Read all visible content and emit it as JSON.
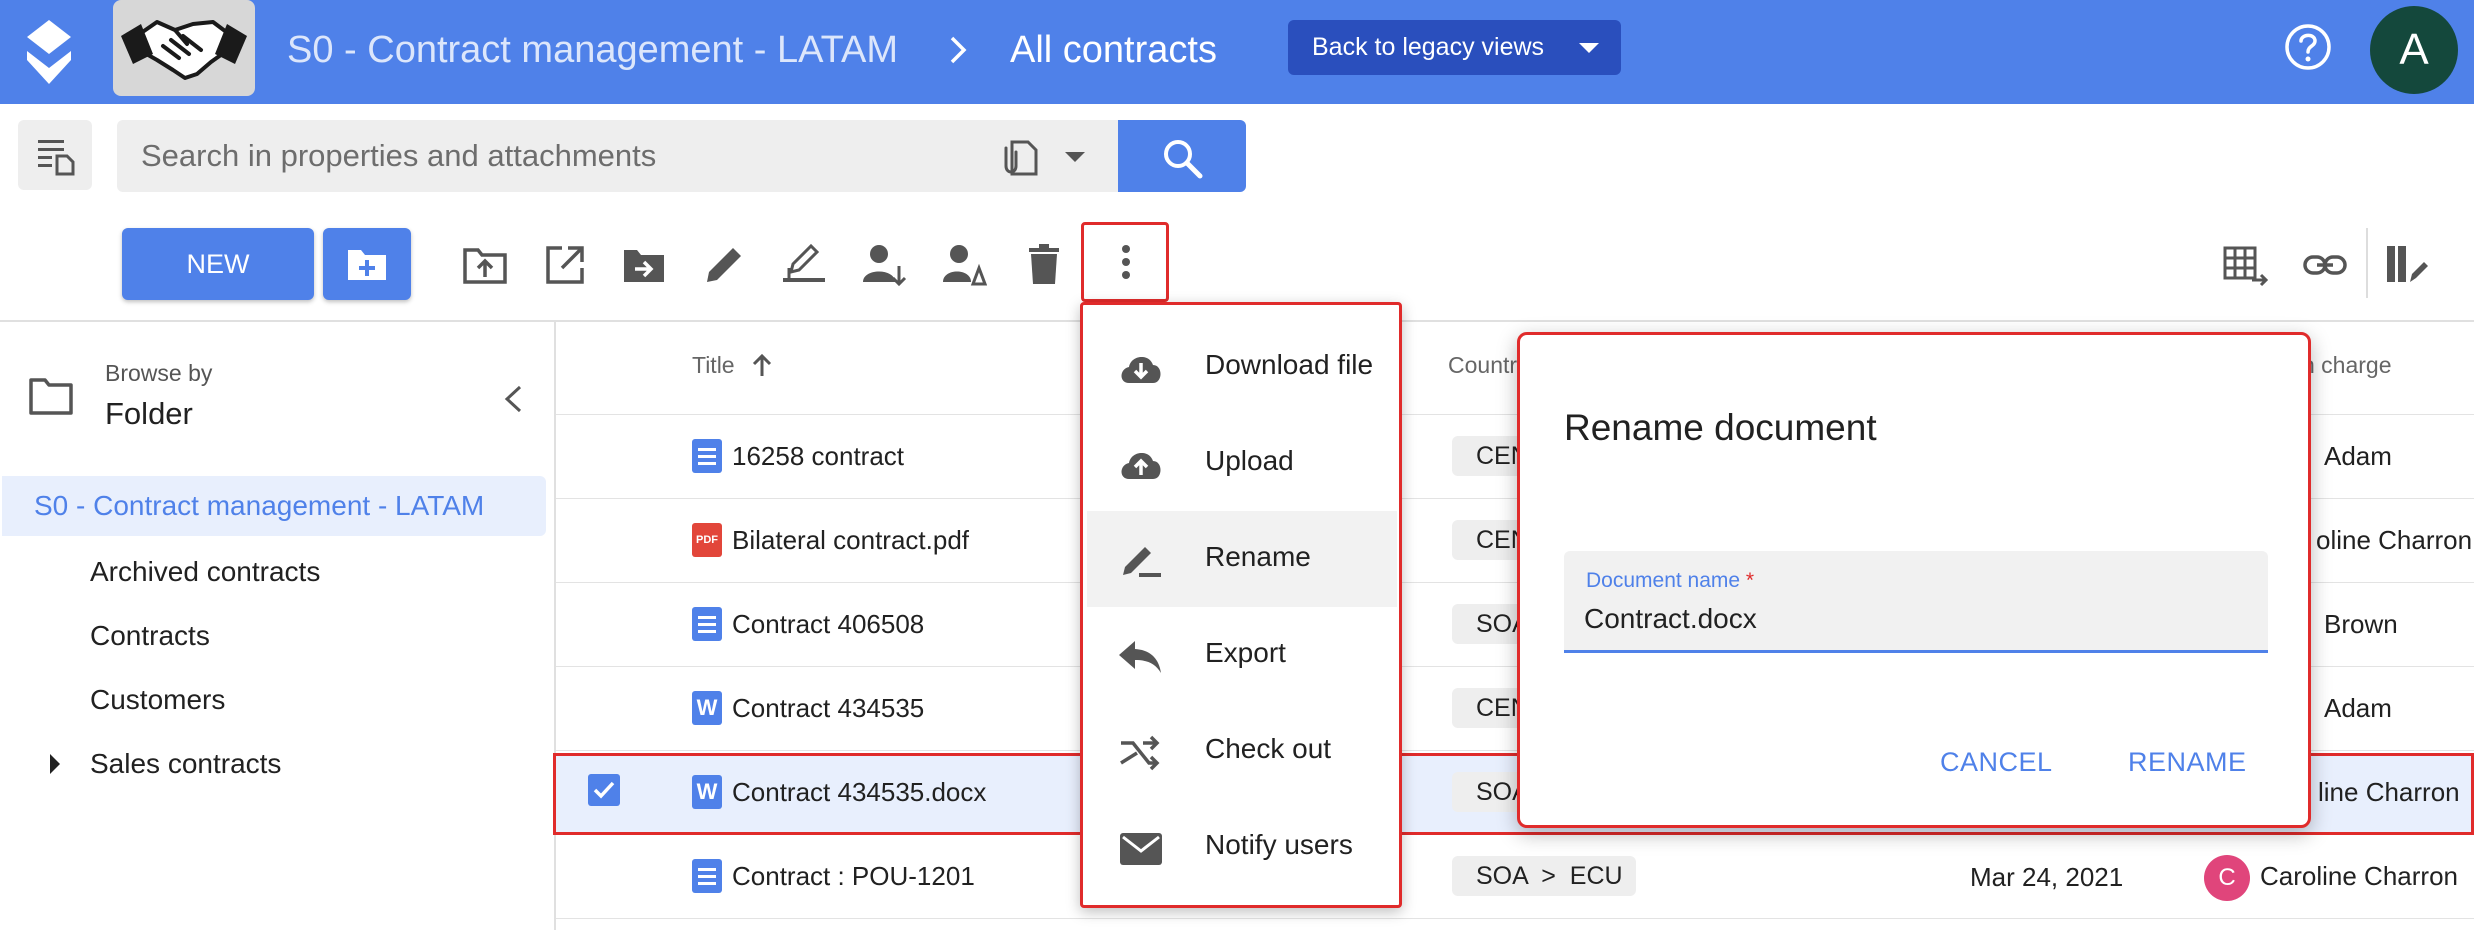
{
  "header": {
    "breadcrumb_root": "S0 - Contract management - LATAM",
    "breadcrumb_current": "All contracts",
    "legacy_button": "Back to legacy views",
    "user_initial": "A"
  },
  "search": {
    "placeholder": "Search in properties and attachments"
  },
  "toolbar": {
    "new_label": "NEW"
  },
  "sidebar": {
    "browse_by": "Browse by",
    "browse_mode": "Folder",
    "root": "S0 - Contract management - LATAM",
    "children": [
      "Archived contracts",
      "Contracts",
      "Customers",
      "Sales contracts"
    ]
  },
  "table": {
    "columns": {
      "title": "Title",
      "country": "Countr",
      "in_charge": "n charge"
    },
    "rows": [
      {
        "title": "16258 contract",
        "country": "CEN",
        "in_charge": "Adam"
      },
      {
        "title": "Bilateral contract.pdf",
        "country": "CEN",
        "in_charge": "oline Charron"
      },
      {
        "title": "Contract 406508",
        "country": "SOA",
        "in_charge": "Brown"
      },
      {
        "title": "Contract 434535",
        "country": "CEN",
        "in_charge": "Adam"
      },
      {
        "title": "Contract 434535.docx",
        "country": "SOA",
        "in_charge": "line Charron"
      },
      {
        "title": "Contract : POU-1201",
        "country": "SOA  >  ECU",
        "date": "Mar 24, 2021",
        "in_charge": "Caroline Charron",
        "avatar_initial": "C"
      }
    ]
  },
  "menu": {
    "items": [
      "Download file",
      "Upload",
      "Rename",
      "Export",
      "Check out",
      "Notify users"
    ],
    "highlighted": "Rename"
  },
  "dialog": {
    "title": "Rename document",
    "field_label": "Document name",
    "field_required_mark": "*",
    "field_value": "Contract.docx",
    "cancel": "CANCEL",
    "confirm": "RENAME"
  },
  "colors": {
    "header_bg": "#4f81e9",
    "legacy_button_bg": "#2a4fbd",
    "highlight_border": "#e02b2b",
    "selected_row_bg": "#e8effd",
    "avatar_top_bg": "#14483c",
    "avatar_user_bg": "#e0457b"
  }
}
